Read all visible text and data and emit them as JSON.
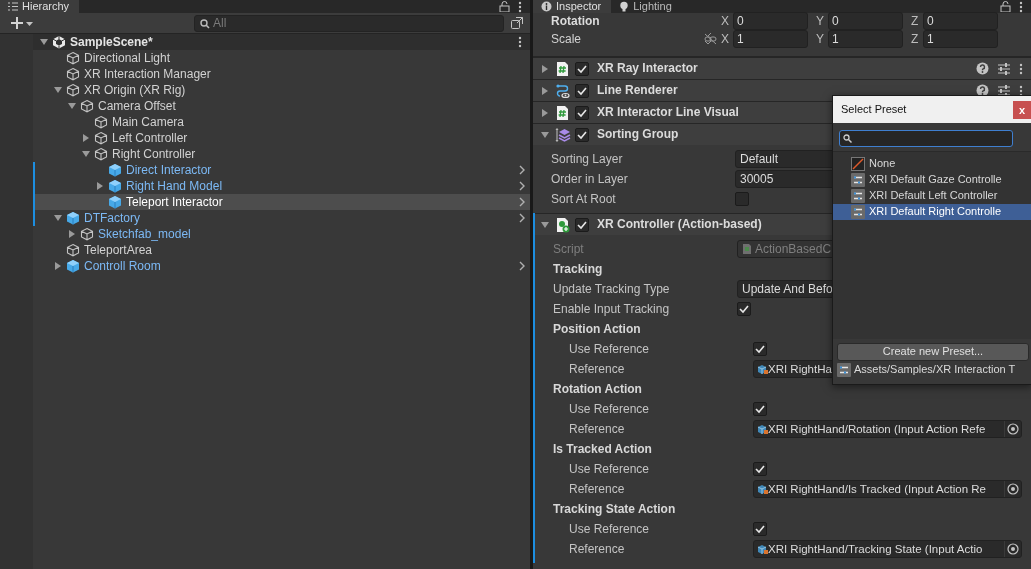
{
  "hierarchy": {
    "tab": {
      "label": "Hierarchy",
      "selected": true
    },
    "search": {
      "placeholder": "All"
    },
    "tree": [
      {
        "name": "SampleScene*",
        "kind": "scene",
        "expanded": true,
        "children": [
          {
            "name": "Directional Light",
            "kind": "object"
          },
          {
            "name": "XR Interaction Manager",
            "kind": "object"
          },
          {
            "name": "XR Origin (XR Rig)",
            "kind": "object",
            "expanded": true,
            "children": [
              {
                "name": "Camera Offset",
                "kind": "object",
                "expanded": true,
                "children": [
                  {
                    "name": "Main Camera",
                    "kind": "object"
                  },
                  {
                    "name": "Left Controller",
                    "kind": "object",
                    "expanded": false
                  },
                  {
                    "name": "Right Controller",
                    "kind": "object",
                    "expanded": true,
                    "children": [
                      {
                        "name": "Direct Interactor",
                        "kind": "prefab",
                        "linked": true,
                        "modified": true,
                        "selected": false
                      },
                      {
                        "name": "Right Hand Model",
                        "kind": "prefab",
                        "linked": true,
                        "modified": true,
                        "selected": false,
                        "expanded": false
                      },
                      {
                        "name": "Teleport Interactor",
                        "kind": "prefab",
                        "linked": true,
                        "modified": true,
                        "selected": true
                      }
                    ]
                  }
                ]
              }
            ]
          },
          {
            "name": "DTFactory",
            "kind": "prefab",
            "linked": true,
            "modified": true,
            "selected": false,
            "expanded": true,
            "children": [
              {
                "name": "Sketchfab_model",
                "kind": "object",
                "linked": true,
                "expanded": false
              }
            ]
          },
          {
            "name": "TeleportArea",
            "kind": "object"
          },
          {
            "name": "Controll Room",
            "kind": "prefab",
            "linked": true,
            "selected": false,
            "expanded": false
          }
        ]
      }
    ]
  },
  "inspector": {
    "tabs": [
      {
        "label": "Inspector",
        "kind": "info",
        "selected": true
      },
      {
        "label": "Lighting",
        "kind": "bulb",
        "selected": false
      }
    ],
    "transform": [
      {
        "label": "Rotation",
        "overridden": true,
        "values": [
          {
            "axis": "X",
            "value": "0"
          },
          {
            "axis": "Y",
            "value": "0"
          },
          {
            "axis": "Z",
            "value": "0"
          }
        ]
      },
      {
        "label": "Scale",
        "overridden": false,
        "proportional": false,
        "values": [
          {
            "axis": "X",
            "value": "1"
          },
          {
            "axis": "Y",
            "value": "1"
          },
          {
            "axis": "Z",
            "value": "1"
          }
        ]
      }
    ],
    "components": [
      {
        "name": "XR Ray Interactor",
        "kind": "script",
        "enabled": true,
        "expanded": false,
        "header_icons": true
      },
      {
        "name": "Line Renderer",
        "kind": "line",
        "enabled": true,
        "expanded": false,
        "header_icons": true
      },
      {
        "name": "XR Interactor Line Visual",
        "kind": "script",
        "enabled": true,
        "expanded": false,
        "header_icons": false
      },
      {
        "name": "Sorting Group",
        "kind": "layers",
        "enabled": true,
        "expanded": true,
        "header_icons": false,
        "fields": [
          {
            "kind": "dropdown",
            "label": "Sorting Layer",
            "value": "Default"
          },
          {
            "kind": "number",
            "label": "Order in Layer",
            "value": "30005"
          },
          {
            "kind": "checkbox",
            "label": "Sort At Root",
            "checked": false
          }
        ]
      },
      {
        "name": "XR Controller (Action-based)",
        "kind": "controller",
        "enabled": true,
        "expanded": true,
        "modified": true,
        "header_icons": false,
        "fields": [
          {
            "kind": "script",
            "label": "Script",
            "value": "ActionBasedC",
            "disabled": true
          },
          {
            "kind": "header",
            "label": "Tracking"
          },
          {
            "kind": "dropdown",
            "label": "Update Tracking Type",
            "value": "Update And Befo"
          },
          {
            "kind": "checkbox",
            "label": "Enable Input Tracking",
            "checked": true
          },
          {
            "kind": "group",
            "label": "Position Action",
            "children": [
              {
                "kind": "checkbox",
                "label": "Use Reference",
                "checked": true
              },
              {
                "kind": "object",
                "label": "Reference",
                "value": "XRI RightHa",
                "picker": false
              }
            ]
          },
          {
            "kind": "group",
            "label": "Rotation Action",
            "children": [
              {
                "kind": "checkbox",
                "label": "Use Reference",
                "checked": true
              },
              {
                "kind": "object",
                "label": "Reference",
                "value": "XRI RightHand/Rotation (Input Action Refe",
                "picker": true
              }
            ]
          },
          {
            "kind": "group",
            "label": "Is Tracked Action",
            "children": [
              {
                "kind": "checkbox",
                "label": "Use Reference",
                "checked": true
              },
              {
                "kind": "object",
                "label": "Reference",
                "value": "XRI RightHand/Is Tracked (Input Action Re",
                "picker": true
              }
            ]
          },
          {
            "kind": "group",
            "label": "Tracking State Action",
            "children": [
              {
                "kind": "checkbox",
                "label": "Use Reference",
                "checked": true
              },
              {
                "kind": "object",
                "label": "Reference",
                "value": "XRI RightHand/Tracking State (Input Actio",
                "picker": true
              }
            ]
          }
        ]
      }
    ]
  },
  "preset_popup": {
    "title": "Select Preset",
    "close": "x",
    "items": [
      {
        "label": "None",
        "kind": "none",
        "selected": false
      },
      {
        "label": "XRI Default Gaze Controlle",
        "kind": "preset",
        "selected": false
      },
      {
        "label": "XRI Default Left Controller",
        "kind": "preset",
        "selected": false
      },
      {
        "label": "XRI Default Right Controlle",
        "kind": "preset",
        "selected": true
      }
    ],
    "create_button": "Create new Preset...",
    "path": "Assets/Samples/XR Interaction T"
  }
}
